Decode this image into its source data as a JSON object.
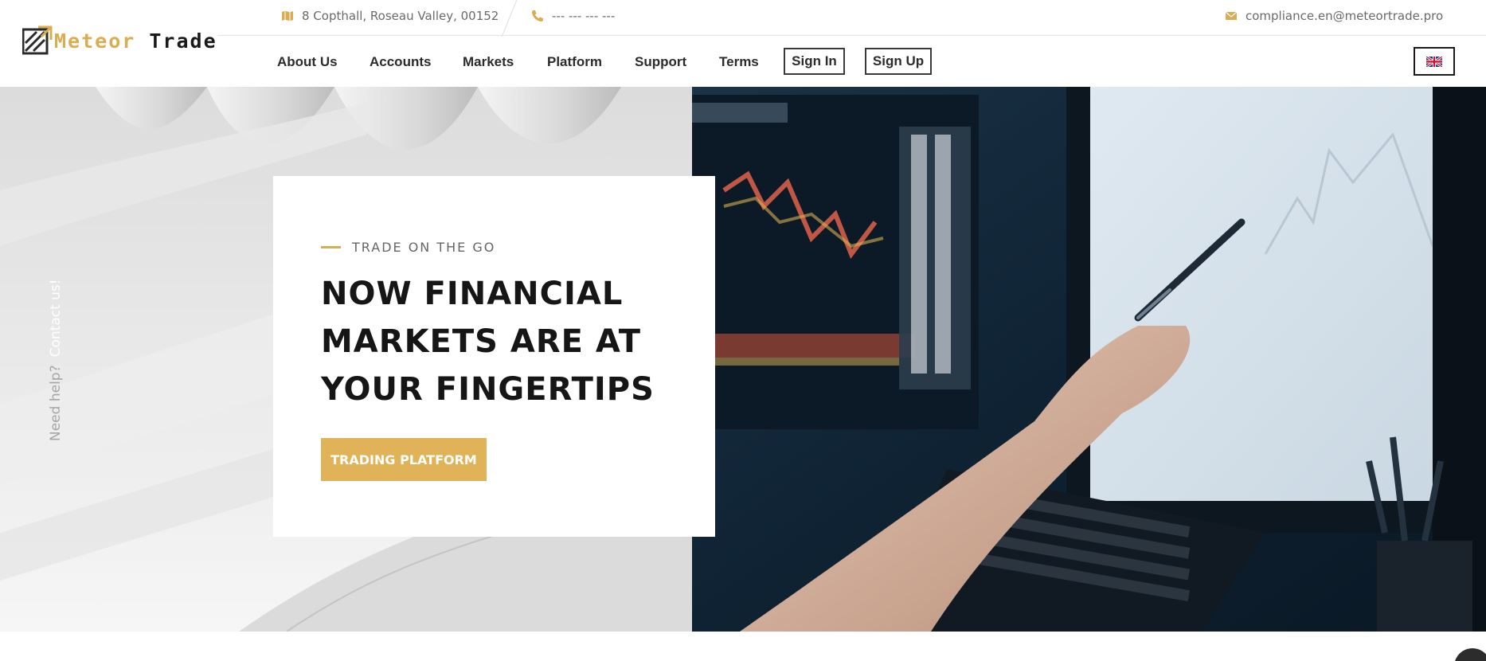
{
  "brand": {
    "word1": "Meteor",
    "word2": "Trade",
    "accent_color": "#d9ad51"
  },
  "topbar": {
    "address": "8 Copthall, Roseau Valley, 00152",
    "address_icon": "map-icon",
    "phone": "--- --- --- ---",
    "phone_icon": "phone-icon",
    "email": "compliance.en@meteortrade.pro",
    "email_icon": "envelope-icon"
  },
  "nav": {
    "items": [
      {
        "label": "About Us"
      },
      {
        "label": "Accounts"
      },
      {
        "label": "Markets"
      },
      {
        "label": "Platform"
      },
      {
        "label": "Support"
      },
      {
        "label": "Terms"
      }
    ],
    "sign_in": "Sign In",
    "sign_up": "Sign Up",
    "language_icon": "uk-flag-icon"
  },
  "hero": {
    "side_help": "Need help?",
    "side_contact": "Contact us!",
    "eyebrow": "TRADE ON THE GO",
    "headline_line1": "NOW FINANCIAL",
    "headline_line2": "MARKETS ARE AT",
    "headline_line3": "YOUR FINGERTIPS",
    "cta_label": "TRADING PLATFORM",
    "cta_color": "#e0b358"
  }
}
